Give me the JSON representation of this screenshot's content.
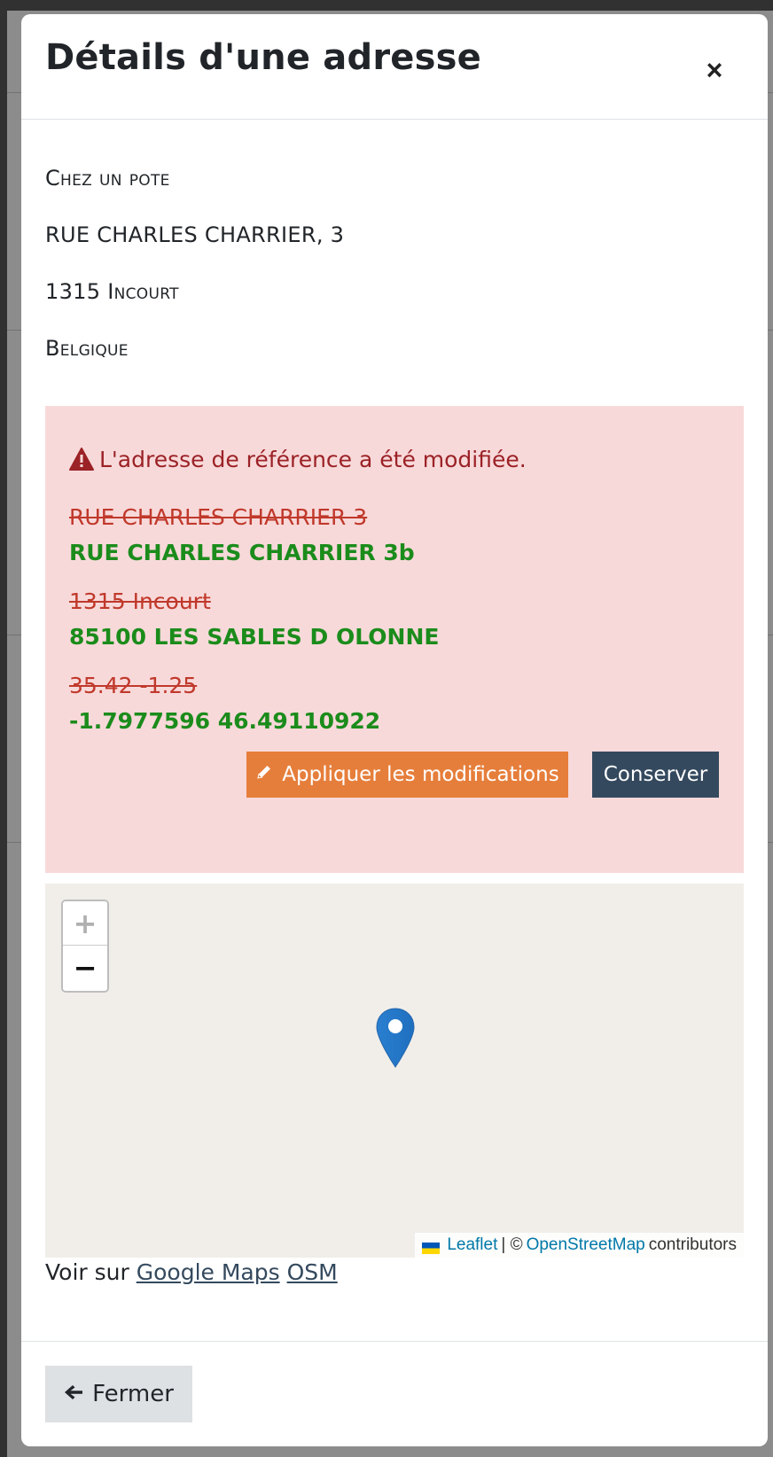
{
  "modal": {
    "title": "Détails d'une adresse",
    "close_symbol": "×"
  },
  "address": {
    "name": "Chez un pote",
    "street": "RUE CHARLES CHARRIER, 3",
    "city": "1315 Incourt",
    "country": "Belgique"
  },
  "alert": {
    "icon": "warning-triangle-icon",
    "message": "L'adresse de référence a été modifiée.",
    "changes": [
      {
        "old": "RUE CHARLES CHARRIER 3",
        "new": "RUE CHARLES CHARRIER 3b"
      },
      {
        "old": "1315 Incourt",
        "new": "85100 LES SABLES D OLONNE"
      },
      {
        "old": "35.42 -1.25",
        "new": "-1.7977596 46.49110922"
      }
    ],
    "apply_label": "Appliquer les modifications",
    "apply_icon": "pencil-icon",
    "keep_label": "Conserver",
    "colors": {
      "background": "#f8d9da",
      "old": "#c0392b",
      "new": "#1b8c1b",
      "apply": "#e67e3b",
      "keep": "#34495e"
    }
  },
  "map": {
    "zoom_in": "+",
    "zoom_out": "−",
    "marker_icon": "map-marker-icon",
    "attribution": {
      "leaflet": "Leaflet",
      "separator": "| ©",
      "osm": "OpenStreetMap",
      "contributors": "contributors"
    }
  },
  "links": {
    "prefix": "Voir sur",
    "google": "Google Maps",
    "osm": "OSM"
  },
  "footer": {
    "close_label": "Fermer",
    "close_icon": "arrow-left-icon"
  }
}
